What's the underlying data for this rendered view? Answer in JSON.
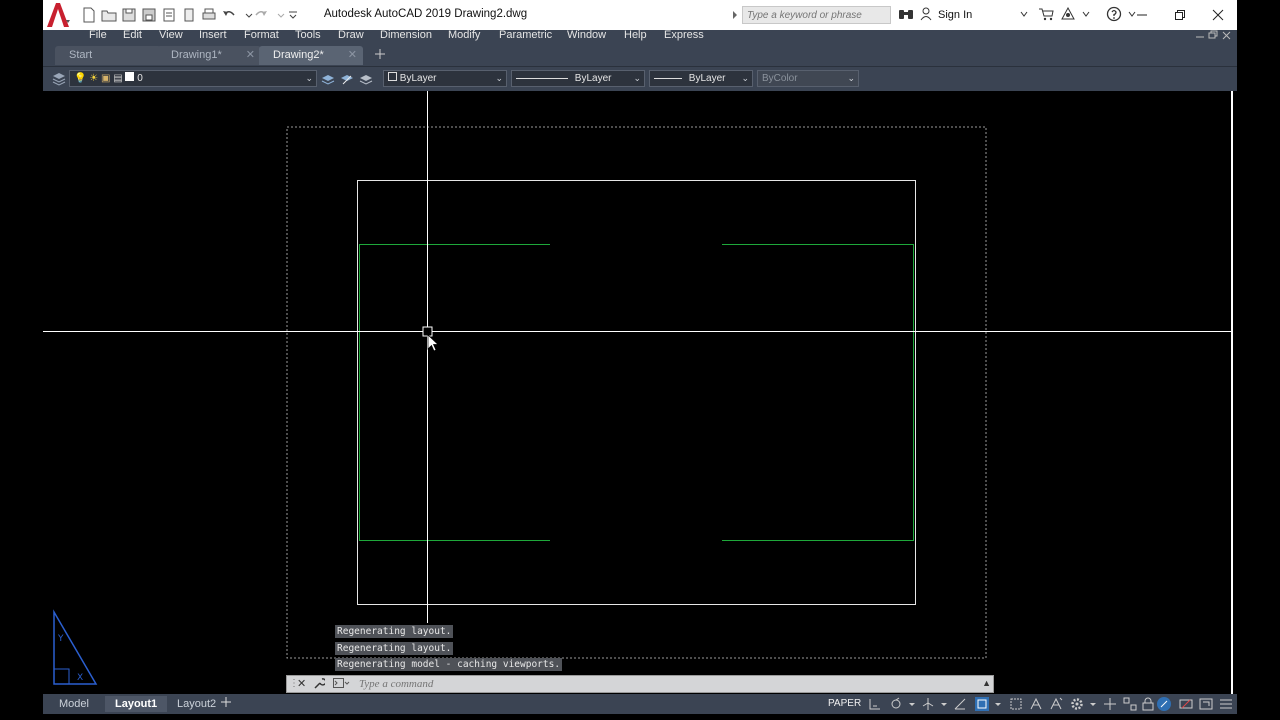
{
  "app": {
    "logo_letter": "A",
    "title": "Autodesk AutoCAD 2019    Drawing2.dwg"
  },
  "search": {
    "placeholder": "Type a keyword or phrase"
  },
  "account": {
    "sign_in": "Sign In"
  },
  "menu": [
    "File",
    "Edit",
    "View",
    "Insert",
    "Format",
    "Tools",
    "Draw",
    "Dimension",
    "Modify",
    "Parametric",
    "Window",
    "Help",
    "Express"
  ],
  "tabs": [
    {
      "label": "Start",
      "active": false
    },
    {
      "label": "Drawing1*",
      "active": false
    },
    {
      "label": "Drawing2*",
      "active": true
    }
  ],
  "toolbar": {
    "layer_value": "0",
    "color_value": "ByLayer",
    "linetype_value": "ByLayer",
    "lineweight_value": "ByLayer",
    "plotstyle_value": "ByColor"
  },
  "command_history": [
    "Regenerating layout.",
    "Regenerating layout.",
    "Regenerating model - caching viewports."
  ],
  "command_line": {
    "placeholder": "Type a command"
  },
  "layout_tabs": [
    {
      "label": "Model",
      "active": false
    },
    {
      "label": "Layout1",
      "active": true
    },
    {
      "label": "Layout2",
      "active": false
    }
  ],
  "status": {
    "space": "PAPER"
  },
  "ucs": {
    "y_label": "Y",
    "x_label": "X"
  },
  "colors": {
    "accent_red": "#c8202f",
    "chrome": "#3b4453",
    "viewport_green": "#1ea83a",
    "canvas": "#000000"
  }
}
